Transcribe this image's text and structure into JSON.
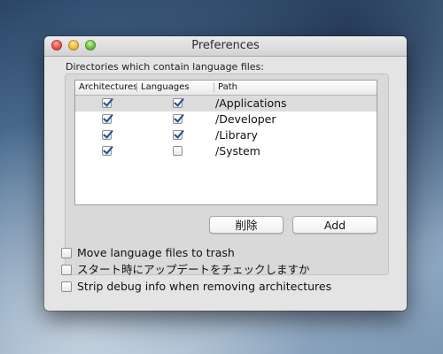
{
  "window": {
    "title": "Preferences"
  },
  "directories_label": "Directories which contain language files:",
  "table": {
    "columns": [
      "Architectures",
      "Languages",
      "Path"
    ],
    "rows": [
      {
        "architectures": true,
        "languages": true,
        "path": "/Applications",
        "selected": true
      },
      {
        "architectures": true,
        "languages": true,
        "path": "/Developer",
        "selected": false
      },
      {
        "architectures": true,
        "languages": true,
        "path": "/Library",
        "selected": false
      },
      {
        "architectures": true,
        "languages": false,
        "path": "/System",
        "selected": false
      }
    ]
  },
  "buttons": {
    "delete": "削除",
    "add": "Add"
  },
  "options": [
    {
      "label": "Move language files to trash",
      "checked": false
    },
    {
      "label": "スタート時にアップデートをチェックしますか",
      "checked": false
    },
    {
      "label": "Strip debug info when removing architectures",
      "checked": false
    }
  ],
  "colors": {
    "checkmark": "#1c4f9c",
    "selected_row": "#dcdcdc",
    "window_bg": "#e4e4e4"
  }
}
